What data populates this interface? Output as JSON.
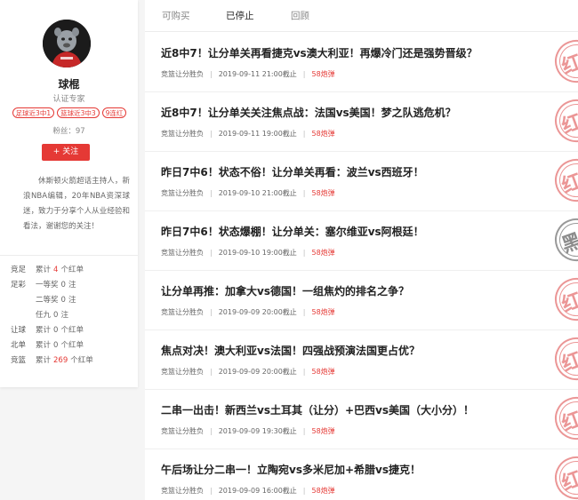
{
  "profile": {
    "name": "球棍",
    "title": "认证专家",
    "tags": [
      "足球近3中1",
      "篮球近3中3",
      "9连红"
    ],
    "fans_label": "粉丝：",
    "fans_count": "97",
    "follow_label": "+ 关注",
    "bio": "休斯顿火箭超话主持人，新浪NBA编辑，20年NBA资深球迷，致力于分享个人从业经验和看法，谢谢您的关注！"
  },
  "stats": [
    {
      "label": "竞足",
      "prefix": "累计",
      "value": "4",
      "suffix": "个红单",
      "highlight": true
    },
    {
      "label": "足彩",
      "prefix": "一等奖",
      "value": "0",
      "suffix": "注",
      "highlight": false
    },
    {
      "label": "",
      "prefix": "二等奖",
      "value": "0",
      "suffix": "注",
      "highlight": false
    },
    {
      "label": "",
      "prefix": "任九",
      "value": "0",
      "suffix": "注",
      "highlight": false
    },
    {
      "label": "让球",
      "prefix": "累计",
      "value": "0",
      "suffix": "个红单",
      "highlight": false
    },
    {
      "label": "北单",
      "prefix": "累计",
      "value": "0",
      "suffix": "个红单",
      "highlight": false
    },
    {
      "label": "竞篮",
      "prefix": "累计",
      "value": "269",
      "suffix": "个红单",
      "highlight": true
    }
  ],
  "tabs": [
    {
      "label": "可购买",
      "active": false
    },
    {
      "label": "已停止",
      "active": true
    },
    {
      "label": "回顾",
      "active": false
    }
  ],
  "items": [
    {
      "title": "近8中7！让分单关再看捷克vs澳大利亚！再爆冷门还是强势晋级？",
      "category": "竞篮让分胜负",
      "deadline": "2019-09-11 21:00截止",
      "price": "58炮弹",
      "stamp": "红",
      "stamp_color": "red"
    },
    {
      "title": "近8中7！让分单关关注焦点战：法国vs美国！梦之队逃危机？",
      "category": "竞篮让分胜负",
      "deadline": "2019-09-11 19:00截止",
      "price": "58炮弹",
      "stamp": "红",
      "stamp_color": "red"
    },
    {
      "title": "昨日7中6！状态不俗！让分单关再看：波兰vs西班牙！",
      "category": "竞篮让分胜负",
      "deadline": "2019-09-10 21:00截止",
      "price": "58炮弹",
      "stamp": "红",
      "stamp_color": "red"
    },
    {
      "title": "昨日7中6！状态爆棚！让分单关：塞尔维亚vs阿根廷！",
      "category": "竞篮让分胜负",
      "deadline": "2019-09-10 19:00截止",
      "price": "58炮弹",
      "stamp": "黑",
      "stamp_color": "black"
    },
    {
      "title": "让分单再推：加拿大vs德国！一组焦灼的排名之争？",
      "category": "竞篮让分胜负",
      "deadline": "2019-09-09 20:00截止",
      "price": "58炮弹",
      "stamp": "红",
      "stamp_color": "red"
    },
    {
      "title": "焦点对决！澳大利亚vs法国！四强战预演法国更占优？",
      "category": "竞篮让分胜负",
      "deadline": "2019-09-09 20:00截止",
      "price": "58炮弹",
      "stamp": "红",
      "stamp_color": "red"
    },
    {
      "title": "二串一出击！新西兰vs土耳其（让分）+巴西vs美国（大小分）！",
      "category": "竞篮让分胜负",
      "deadline": "2019-09-09 19:30截止",
      "price": "58炮弹",
      "stamp": "红",
      "stamp_color": "red"
    },
    {
      "title": "午后场让分二串一！立陶宛vs多米尼加+希腊vs捷克！",
      "category": "竞篮让分胜负",
      "deadline": "2019-09-09 16:00截止",
      "price": "58炮弹",
      "stamp": "红",
      "stamp_color": "red"
    }
  ],
  "icons": {
    "avatar": "mascot-avatar",
    "stamp": "result-stamp"
  },
  "colors": {
    "accent": "#e53935",
    "stamp_red": "#e57373",
    "stamp_black": "#777777"
  }
}
